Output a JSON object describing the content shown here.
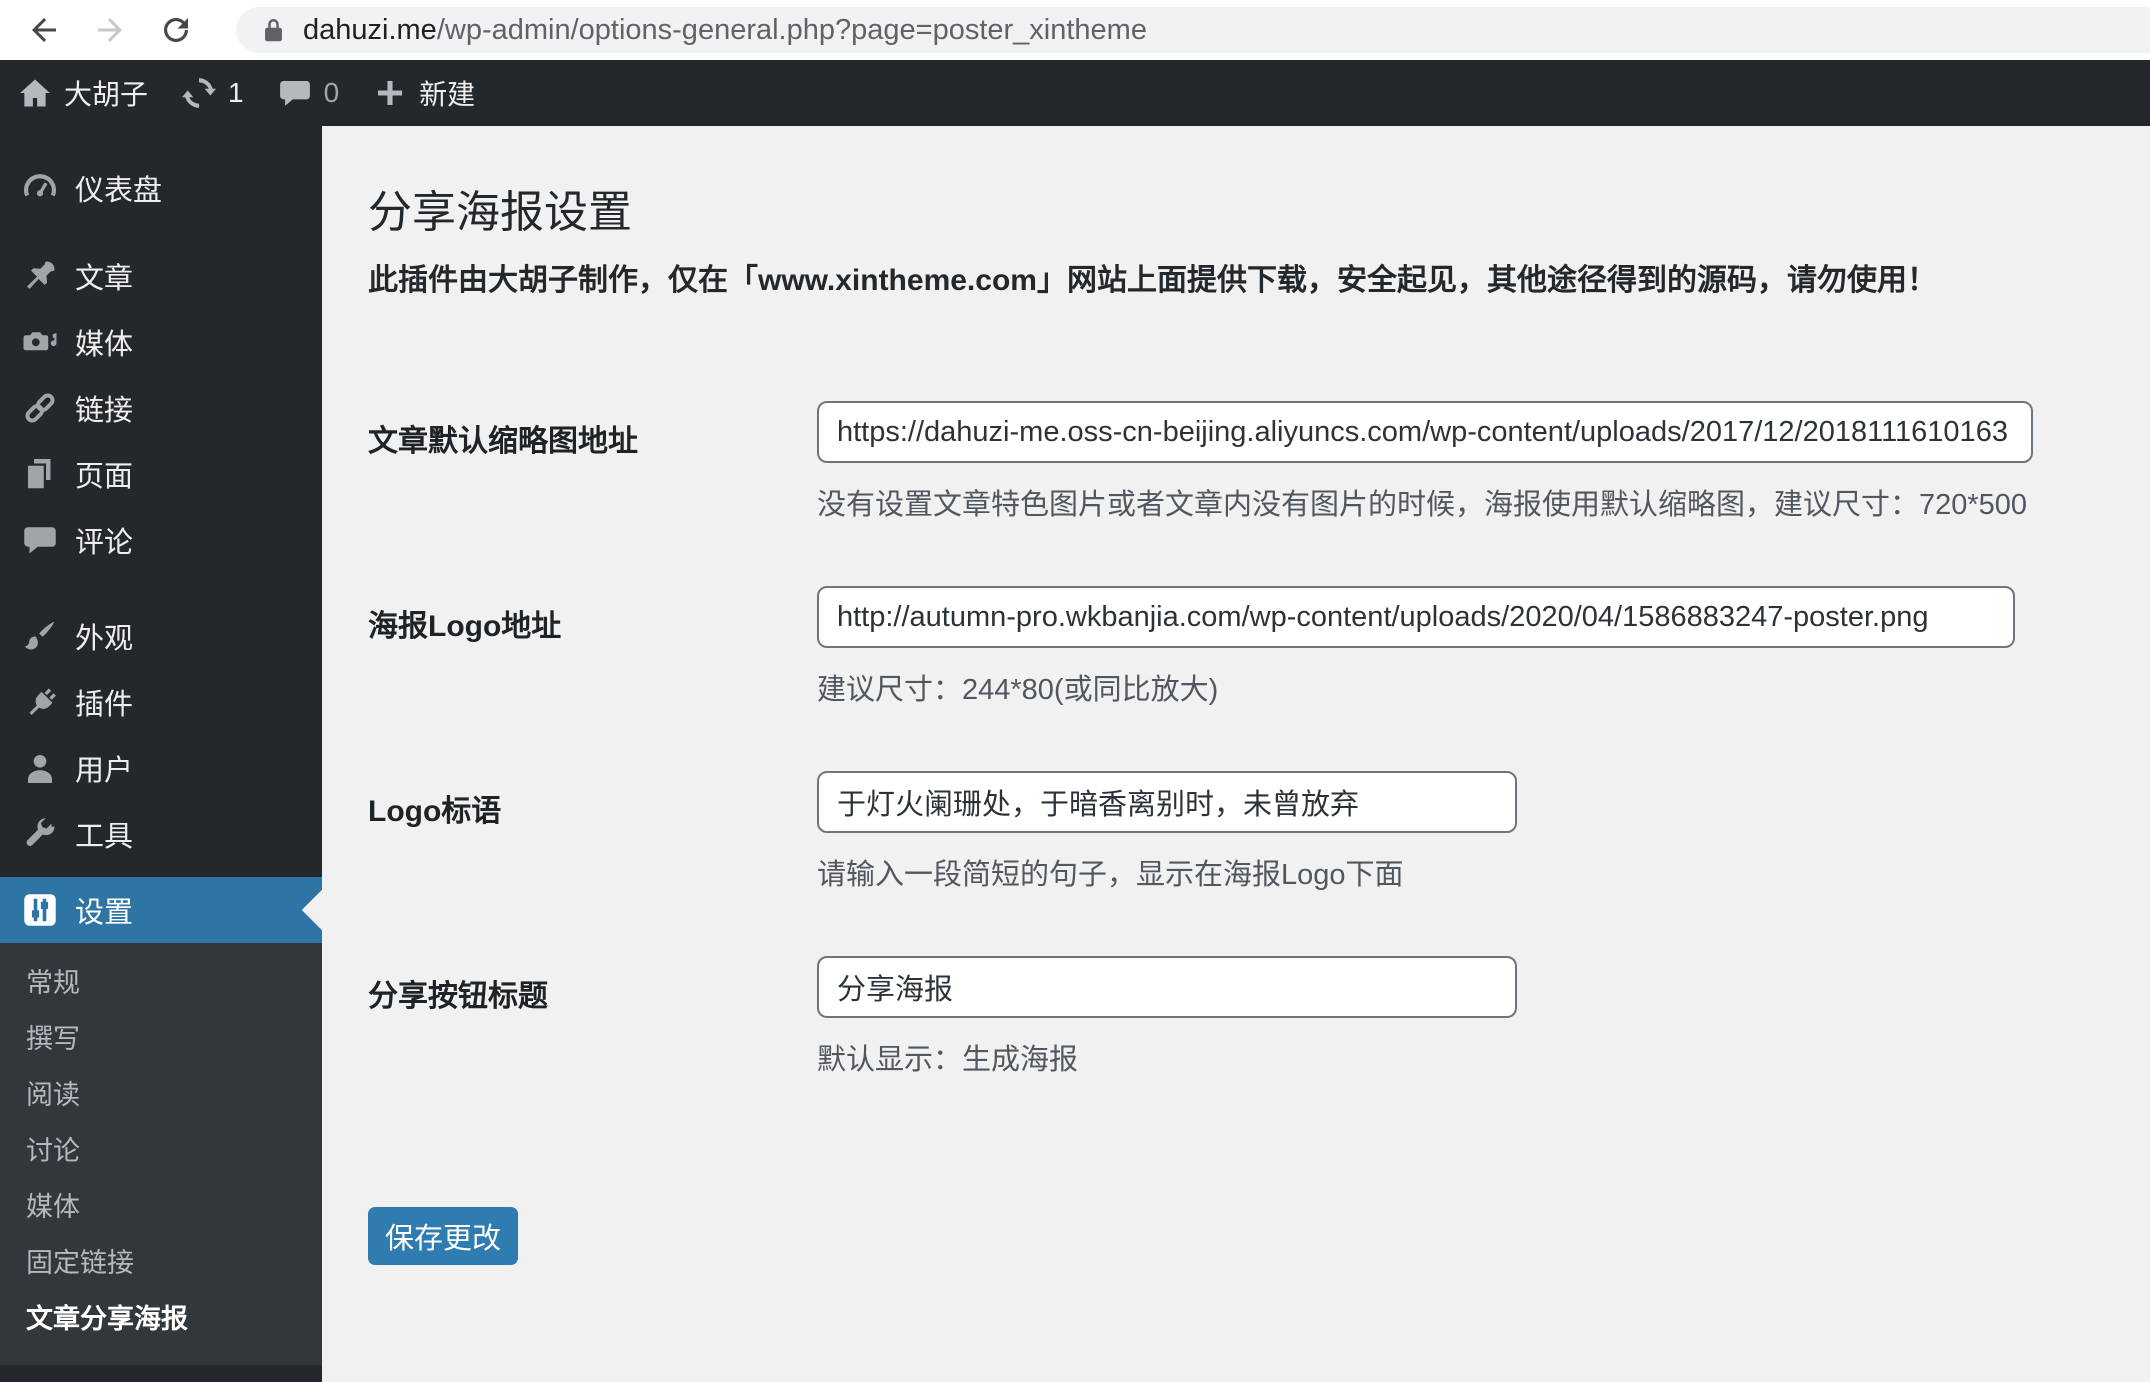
{
  "browser": {
    "url_host": "dahuzi.me",
    "url_path": "/wp-admin/options-general.php?page=poster_xintheme"
  },
  "admin_bar": {
    "site_name": "大胡子",
    "update_count": "1",
    "comment_count": "0",
    "new_label": "新建"
  },
  "sidebar": {
    "items": [
      {
        "label": "仪表盘",
        "icon": "dashboard-icon"
      },
      {
        "label": "文章",
        "icon": "posts-pin-icon"
      },
      {
        "label": "媒体",
        "icon": "media-camera-icon"
      },
      {
        "label": "链接",
        "icon": "links-chain-icon"
      },
      {
        "label": "页面",
        "icon": "pages-icon"
      },
      {
        "label": "评论",
        "icon": "comments-bubble-icon"
      },
      {
        "label": "外观",
        "icon": "appearance-brush-icon"
      },
      {
        "label": "插件",
        "icon": "plugins-plug-icon"
      },
      {
        "label": "用户",
        "icon": "users-icon"
      },
      {
        "label": "工具",
        "icon": "tools-wrench-icon"
      },
      {
        "label": "设置",
        "icon": "settings-sliders-icon",
        "current": true
      }
    ],
    "submenu": [
      "常规",
      "撰写",
      "阅读",
      "讨论",
      "媒体",
      "固定链接",
      "文章分享海报"
    ],
    "current_submenu": "文章分享海报"
  },
  "main": {
    "title": "分享海报设置",
    "notice": "此插件由大胡子制作，仅在「www.xintheme.com」网站上面提供下载，安全起见，其他途径得到的源码，请勿使用！",
    "fields": [
      {
        "label": "文章默认缩略图地址",
        "value": "https://dahuzi-me.oss-cn-beijing.aliyuncs.com/wp-content/uploads/2017/12/2018111610163",
        "hint": "没有设置文章特色图片或者文章内没有图片的时候，海报使用默认缩略图，建议尺寸：720*500"
      },
      {
        "label": "海报Logo地址",
        "value": "http://autumn-pro.wkbanjia.com/wp-content/uploads/2020/04/1586883247-poster.png",
        "hint": "建议尺寸：244*80(或同比放大)"
      },
      {
        "label": "Logo标语",
        "value": "于灯火阑珊处，于暗香离别时，未曾放弃",
        "hint": "请输入一段简短的句子，显示在海报Logo下面"
      },
      {
        "label": "分享按钮标题",
        "value": "分享海报",
        "hint": "默认显示：生成海报"
      }
    ],
    "save_label": "保存更改"
  },
  "colors": {
    "admin_dark": "#23282d",
    "submenu_dark": "#32373c",
    "menu_highlight_blue": "#2e74a4",
    "button_blue": "#2e7cb0",
    "content_bg": "#f1f1f1",
    "address_pill_gray": "#f0f2f4"
  }
}
